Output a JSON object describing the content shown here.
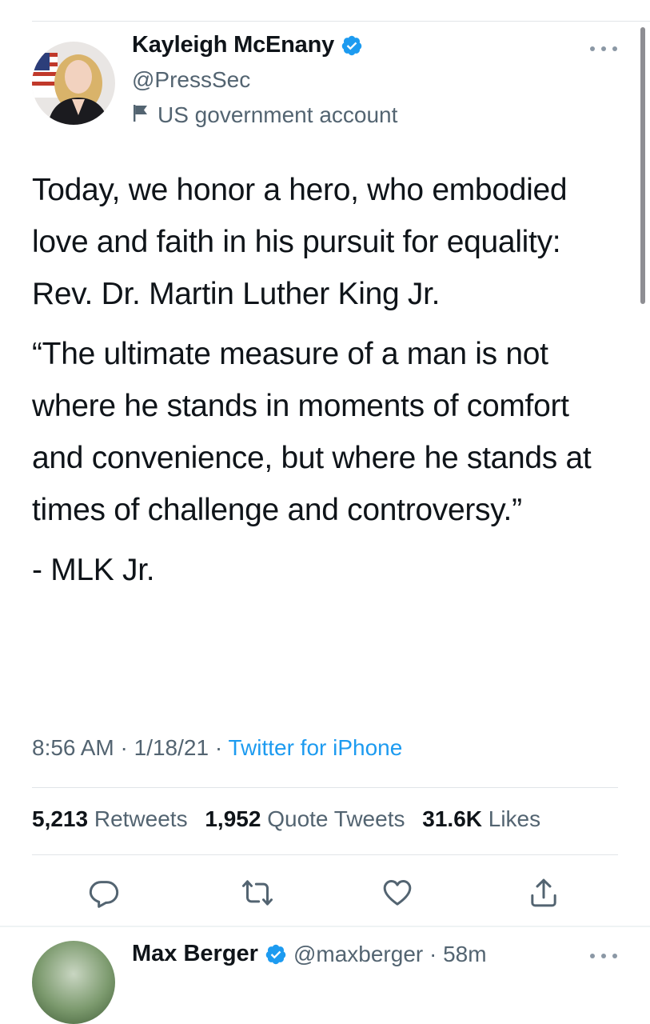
{
  "tweet": {
    "author": {
      "name": "Kayleigh McEnany",
      "handle": "@PressSec",
      "label": "US government account"
    },
    "paragraphs": {
      "p1": "Today, we honor a hero, who embodied love and faith in his pursuit for equality: Rev. Dr. Martin Luther King Jr.",
      "p2": "“The ultimate measure of a man is not where he stands in moments of comfort and convenience, but where he stands at times of challenge and controversy.”",
      "p3": "- MLK Jr."
    },
    "time": "8:56 AM",
    "date": "1/18/21",
    "separator": "·",
    "source": "Twitter for iPhone",
    "stats": {
      "retweets_count": "5,213",
      "retweets_label": "Retweets",
      "quotes_count": "1,952",
      "quotes_label": "Quote Tweets",
      "likes_count": "31.6K",
      "likes_label": "Likes"
    },
    "actions": [
      "reply-icon",
      "retweet-icon",
      "like-icon",
      "share-icon"
    ]
  },
  "next_tweet": {
    "name": "Max Berger",
    "handle_time": "@maxberger · 58m"
  },
  "colors": {
    "text": "#0f1419",
    "secondary": "#536471",
    "link": "#1d9bf0",
    "verified": "#1d9bf0",
    "divider": "#e1e4e8"
  }
}
